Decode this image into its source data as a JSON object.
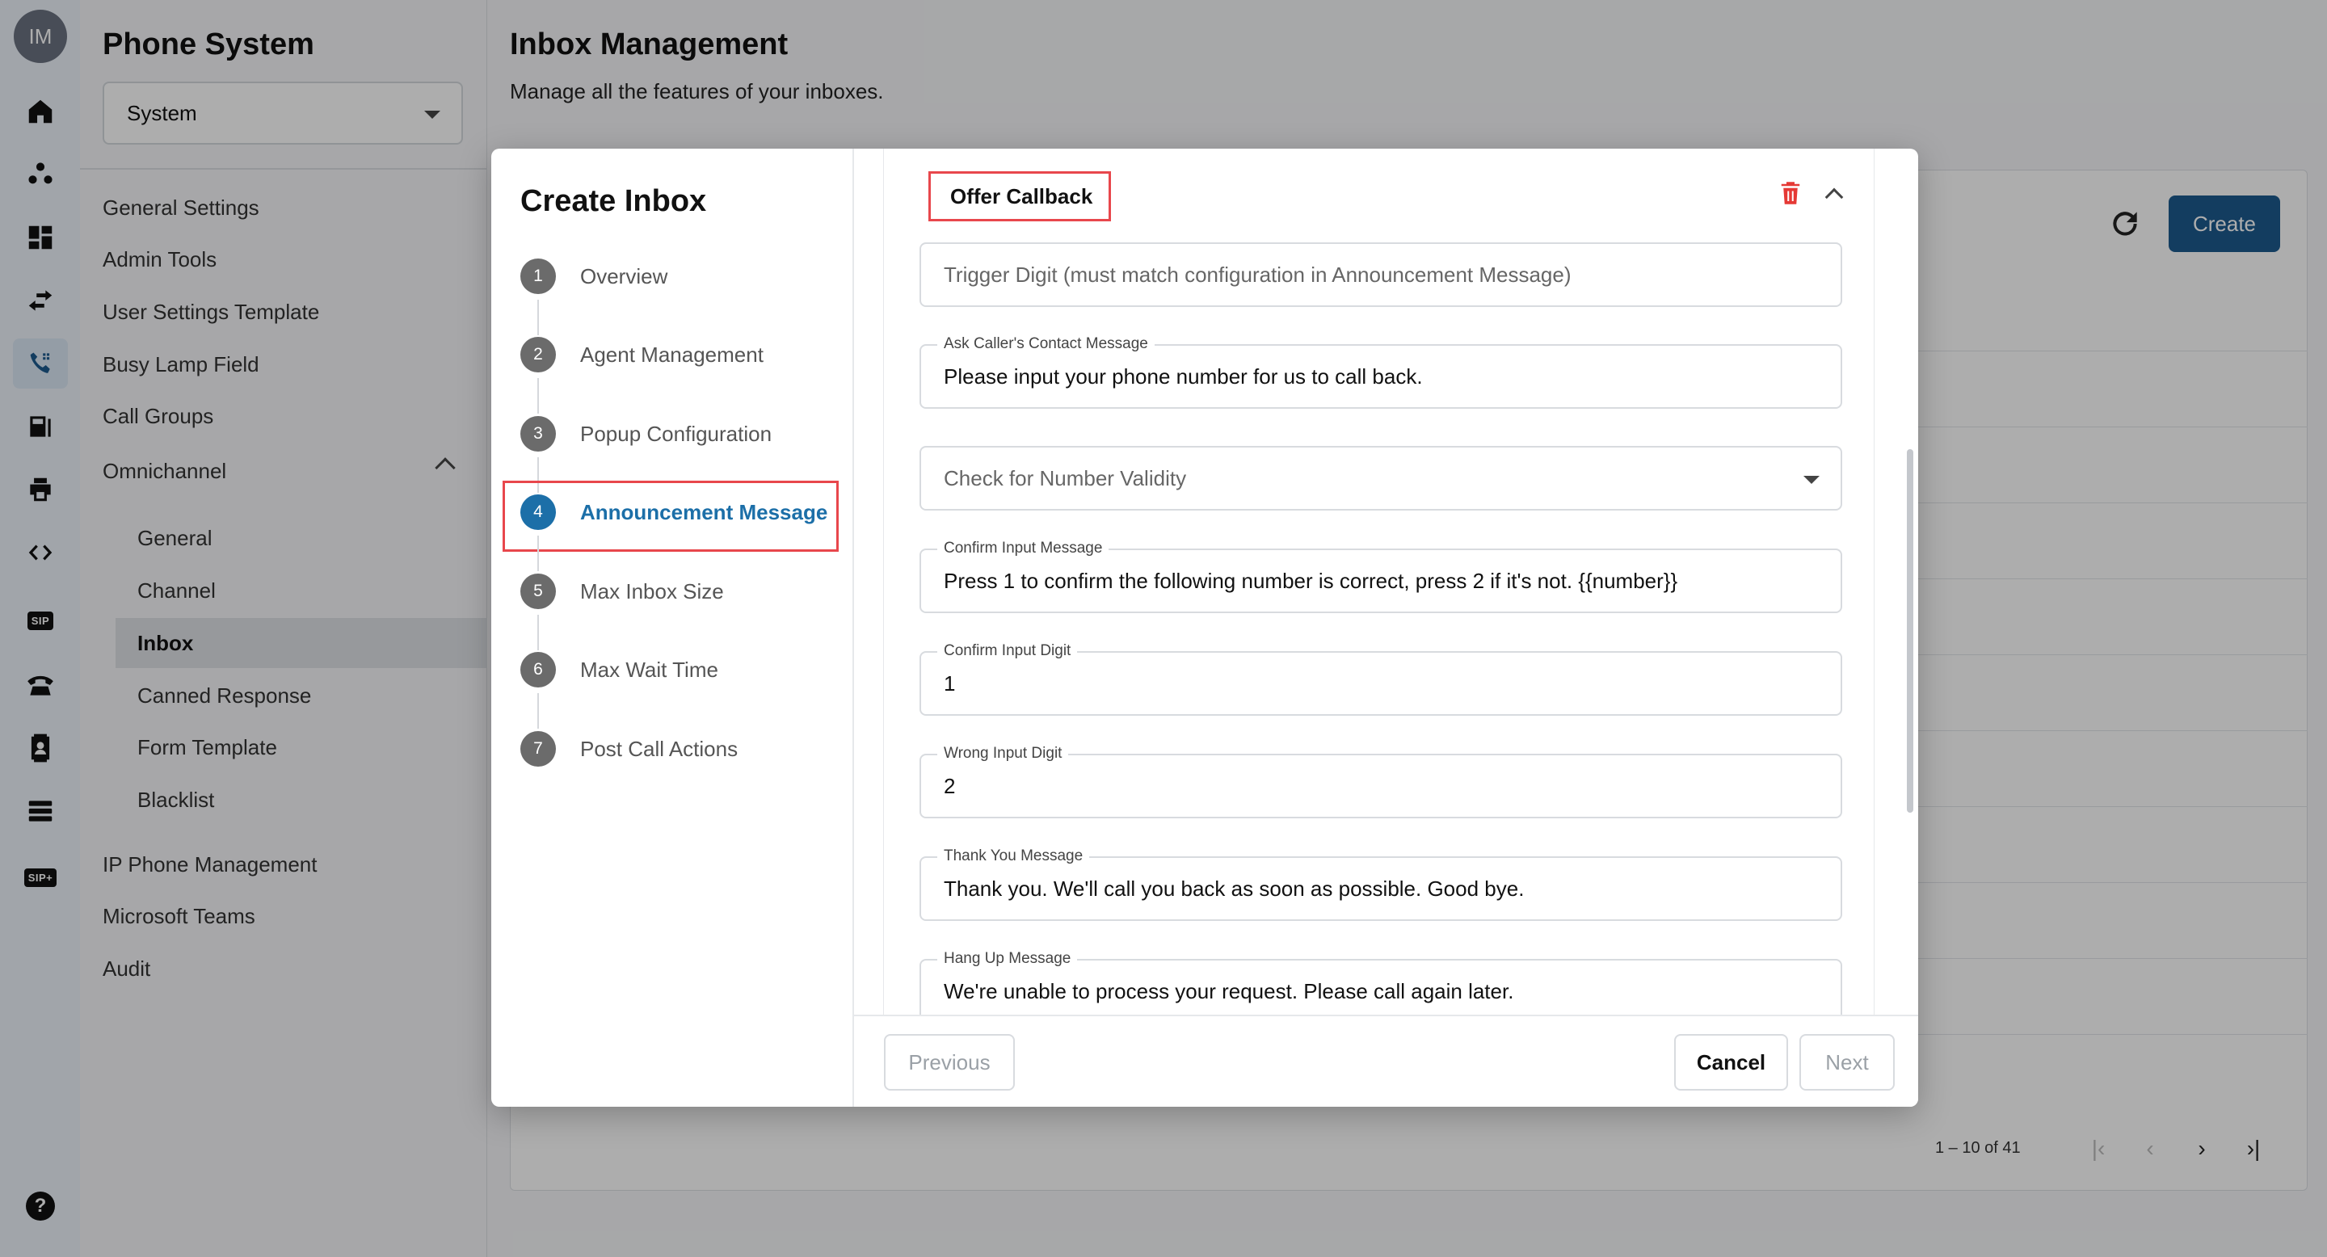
{
  "user": {
    "initials": "IM"
  },
  "rail": {
    "icons": [
      "home-icon",
      "group-icon",
      "dashboard-icon",
      "transfer-icon",
      "phone-icon",
      "fax-icon",
      "printer-icon",
      "code-icon",
      "sip-icon",
      "telephone-icon",
      "contacts-icon",
      "server-icon",
      "sip-plus-icon",
      "help-icon"
    ],
    "active": "phone-icon",
    "sip_label": "SIP",
    "sip_plus_label": "SIP+",
    "help_label": "?"
  },
  "menu": {
    "title": "Phone System",
    "selector_value": "System",
    "items": [
      "General Settings",
      "Admin Tools",
      "User Settings Template",
      "Busy Lamp Field",
      "Call Groups",
      "Omnichannel"
    ],
    "omnichannel_children": [
      "General",
      "Channel",
      "Inbox",
      "Canned Response",
      "Form Template",
      "Blacklist"
    ],
    "active_child": "Inbox",
    "bottom_items": [
      "IP Phone Management",
      "Microsoft Teams",
      "Audit"
    ]
  },
  "main": {
    "title": "Inbox Management",
    "subtitle": "Manage all the features of your inboxes.",
    "create_label": "Create",
    "pagination": "1 – 10 of 41"
  },
  "modal": {
    "title": "Create Inbox",
    "steps": [
      {
        "num": "1",
        "label": "Overview"
      },
      {
        "num": "2",
        "label": "Agent Management"
      },
      {
        "num": "3",
        "label": "Popup Configuration"
      },
      {
        "num": "4",
        "label": "Announcement Message"
      },
      {
        "num": "5",
        "label": "Max Inbox Size"
      },
      {
        "num": "6",
        "label": "Max Wait Time"
      },
      {
        "num": "7",
        "label": "Post Call Actions"
      }
    ],
    "active_step": "4",
    "section_title": "Offer Callback",
    "fields": {
      "trigger_digit": {
        "placeholder": "Trigger Digit (must match configuration in Announcement Message)"
      },
      "ask_contact": {
        "label": "Ask Caller's Contact Message",
        "value": "Please input your phone number for us to call back."
      },
      "validity": {
        "placeholder": "Check for Number Validity"
      },
      "confirm_message": {
        "label": "Confirm Input Message",
        "value": "Press 1 to confirm the following number is correct, press 2 if it's not. {{number}}"
      },
      "confirm_digit": {
        "label": "Confirm Input Digit",
        "value": "1"
      },
      "wrong_digit": {
        "label": "Wrong Input Digit",
        "value": "2"
      },
      "thank_you": {
        "label": "Thank You Message",
        "value": "Thank you. We'll call you back as soon as possible. Good bye."
      },
      "hang_up": {
        "label": "Hang Up Message",
        "value": "We're unable to process your request. Please call again later."
      }
    },
    "footer": {
      "previous": "Previous",
      "cancel": "Cancel",
      "next": "Next"
    }
  },
  "colors": {
    "primary": "#1c5a8e",
    "highlight": "#e8474c",
    "danger": "#e53935"
  }
}
